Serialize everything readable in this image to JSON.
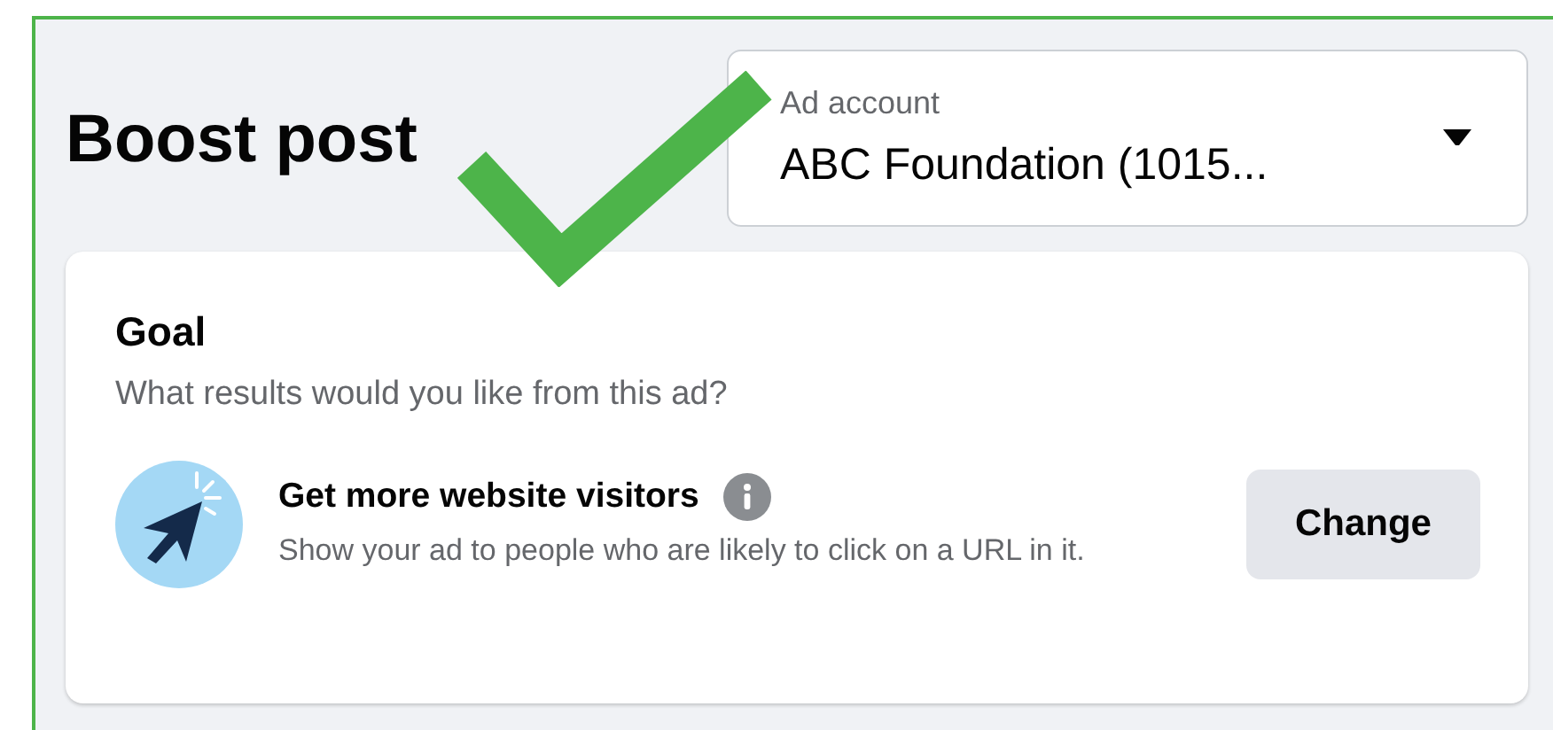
{
  "header": {
    "title": "Boost post"
  },
  "ad_account": {
    "label": "Ad account",
    "value": "ABC Foundation (1015..."
  },
  "goal": {
    "title": "Goal",
    "subtitle": "What results would you like from this ad?",
    "option": {
      "title": "Get more website visitors",
      "description": "Show your ad to people who are likely to click on a URL in it."
    },
    "button": "Change"
  }
}
